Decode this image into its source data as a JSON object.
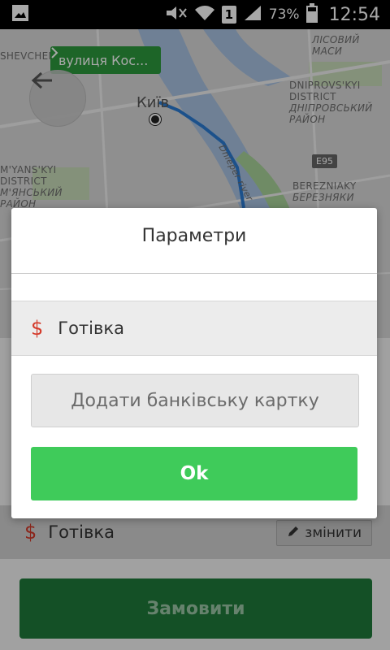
{
  "status_bar": {
    "battery": "73%",
    "time": "12:54",
    "sim": "1",
    "icons": [
      "image-icon",
      "mute-icon",
      "wifi-icon",
      "sim-icon",
      "signal-icon",
      "battery-icon"
    ]
  },
  "map": {
    "street_pill": "вулиця Кос...",
    "city": "Київ",
    "route_color": "#2b7cd3",
    "labels": [
      {
        "text": "ЛІСОВИЙ МАСИ",
        "name": "map-label-lisovyi"
      },
      {
        "text": "DNIPROVS'KYI",
        "name": "map-label-dniprovskyi-en"
      },
      {
        "text": "DISTRICT",
        "name": "map-label-district-1"
      },
      {
        "text": "ДНІПРОВСЬКИЙ",
        "name": "map-label-dniprovskyi-uk"
      },
      {
        "text": "РАЙОН",
        "name": "map-label-raion"
      },
      {
        "text": "BEREZNIAKY",
        "name": "map-label-bereznyaky-en"
      },
      {
        "text": "БЕРЕЗНЯКИ",
        "name": "map-label-bereznyaky-uk"
      },
      {
        "text": "SHEVCHEN",
        "name": "map-label-shevchen"
      },
      {
        "text": "M'YANS'KYI",
        "name": "map-label-solomianskyi-en"
      },
      {
        "text": "DISTRICT",
        "name": "map-label-district-2"
      },
      {
        "text": "М'ЯНСЬКИЙ",
        "name": "map-label-solomianskyi-uk"
      },
      {
        "text": "РАЙОН",
        "name": "map-label-raion-2"
      },
      {
        "text": "Dnieper river",
        "name": "map-label-dnieper"
      }
    ],
    "road_sign": "E95"
  },
  "dialog": {
    "title": "Параметри",
    "option": {
      "label": "Готівка",
      "icon": "dollar-icon"
    },
    "add_card": "Додати банківську картку",
    "ok": "Ok"
  },
  "sheet": {
    "payment_label": "Готівка",
    "change_label": "змінити",
    "order_label": "Замовити"
  },
  "colors": {
    "accent_green": "#3fcb5a",
    "dark_green": "#1f7a3a",
    "dollar_red": "#d43a2a"
  }
}
